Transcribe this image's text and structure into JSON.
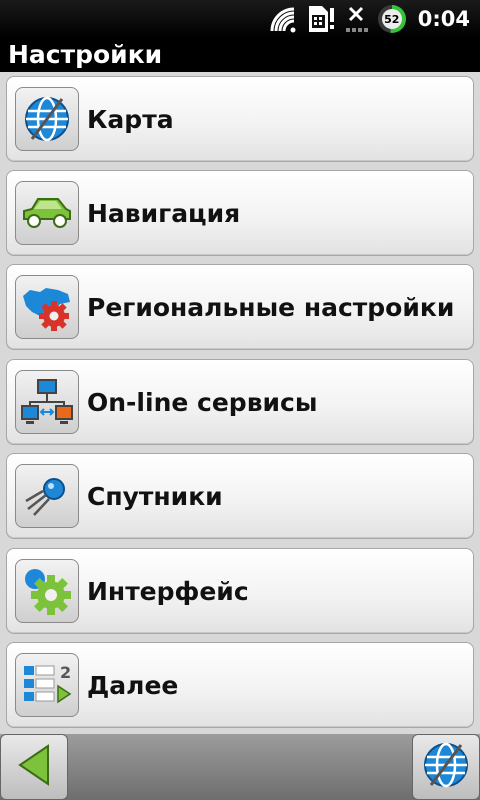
{
  "status": {
    "icons": [
      "wifi-icon",
      "sim-notification-icon",
      "no-signal-icon",
      "battery-icon"
    ],
    "battery_level": "52",
    "time": "0:04"
  },
  "header": {
    "title": "Настройки"
  },
  "menu": {
    "items": [
      {
        "label": "Карта",
        "icon": "globe-icon"
      },
      {
        "label": "Навигация",
        "icon": "car-icon"
      },
      {
        "label": "Региональные настройки",
        "icon": "regional-settings-icon"
      },
      {
        "label": "On-line сервисы",
        "icon": "online-services-icon"
      },
      {
        "label": "Спутники",
        "icon": "satellite-icon"
      },
      {
        "label": "Интерфейс",
        "icon": "interface-gear-icon"
      },
      {
        "label": "Далее",
        "icon": "next-page-icon"
      }
    ]
  },
  "bottom": {
    "back_icon": "back-arrow-icon",
    "map_icon": "globe-icon"
  },
  "colors": {
    "accent_blue": "#1e88d8",
    "green": "#7cc23a",
    "red_gear": "#d8332a",
    "background": "#d8d8d8"
  }
}
